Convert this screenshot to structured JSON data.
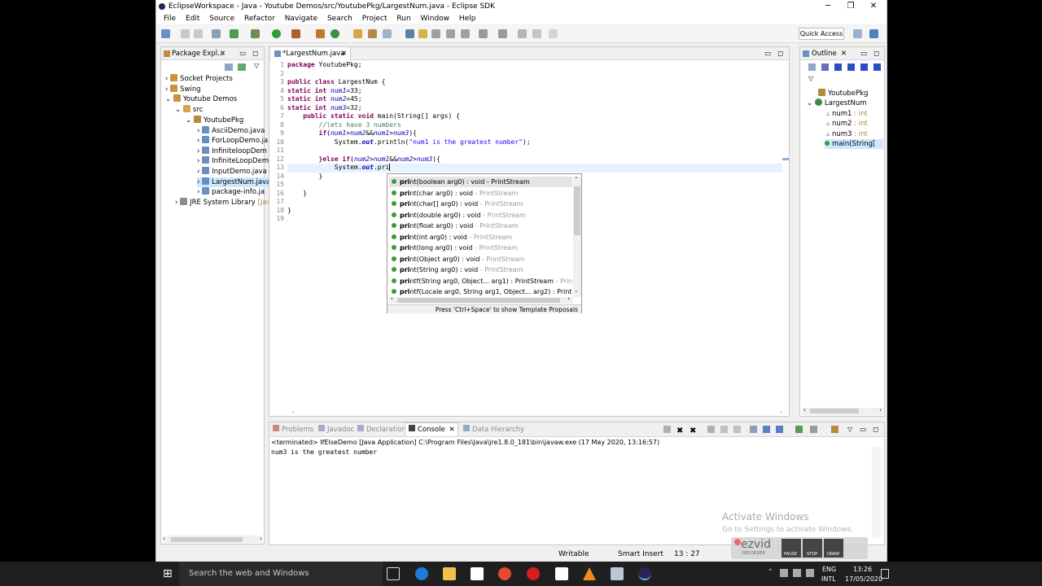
{
  "window": {
    "title": "EclipseWorkspace - Java - Youtube Demos/src/YoutubePkg/LargestNum.java - Eclipse SDK"
  },
  "menu": [
    "File",
    "Edit",
    "Source",
    "Refactor",
    "Navigate",
    "Search",
    "Project",
    "Run",
    "Window",
    "Help"
  ],
  "quick_access": "Quick Access",
  "package_explorer": {
    "tab": "Package Expl...",
    "items": [
      {
        "label": "Socket Projects"
      },
      {
        "label": "Swing"
      },
      {
        "label": "Youtube Demos"
      },
      {
        "label": "src"
      },
      {
        "label": "YoutubePkg"
      },
      {
        "label": "AsciiDemo.java"
      },
      {
        "label": "ForLoopDemo.ja"
      },
      {
        "label": "InfiniteloopDem"
      },
      {
        "label": "InfiniteLoopDem"
      },
      {
        "label": "InputDemo.java"
      },
      {
        "label": "LargestNum.java"
      },
      {
        "label": "package-info.ja"
      },
      {
        "label": "JRE System Library"
      },
      {
        "label": "[Java"
      }
    ]
  },
  "editor": {
    "tab": "*LargestNum.java",
    "lines": [
      "1",
      "2",
      "3",
      "4",
      "5",
      "6",
      "7",
      "8",
      "9",
      "10",
      "11",
      "12",
      "13",
      "14",
      "15",
      "16",
      "17",
      "18",
      "19"
    ],
    "code": {
      "l1a": "package",
      "l1b": " YoutubePkg;",
      "l3a": "public class",
      "l3b": " LargestNum {",
      "static": "static int",
      "num1": "num1",
      "num2": "num2",
      "num3": "num3",
      "v33": "=33;",
      "v45": "=45;",
      "v32": "=32;",
      "l7a": "    public static void",
      "l7b": " main(String[] args) {",
      "l8": "        //lets have 3 numbers",
      "if1a": "        if(",
      "if1b": ">",
      "if1c": "&&",
      "if1d": ">",
      "if1e": "){",
      "l10a": "            System.",
      "out": "out",
      "l10b": ".println(",
      "l10c": "\"num1 is the greatest number\"",
      "l10d": ");",
      "l12a": "        }else if(",
      "l12b": "){",
      "l13": "            System.",
      "l13b": ".pri",
      "l14": "        }",
      "l16": "    }",
      "l18": "}"
    }
  },
  "autocomplete": {
    "items": [
      {
        "bold": "pri",
        "rest": "nt(boolean arg0) : void - PrintStream",
        "type": ""
      },
      {
        "bold": "pri",
        "rest": "nt(char arg0) : void",
        "type": " - PrintStream"
      },
      {
        "bold": "pri",
        "rest": "nt(char[] arg0) : void",
        "type": " - PrintStream"
      },
      {
        "bold": "pri",
        "rest": "nt(double arg0) : void",
        "type": " - PrintStream"
      },
      {
        "bold": "pri",
        "rest": "nt(float arg0) : void",
        "type": " - PrintStream"
      },
      {
        "bold": "pri",
        "rest": "nt(int arg0) : void",
        "type": " - PrintStream"
      },
      {
        "bold": "pri",
        "rest": "nt(long arg0) : void",
        "type": " - PrintStream"
      },
      {
        "bold": "pri",
        "rest": "nt(Object arg0) : void",
        "type": " - PrintStream"
      },
      {
        "bold": "pri",
        "rest": "nt(String arg0) : void",
        "type": " - PrintStream"
      },
      {
        "bold": "pri",
        "rest": "ntf(String arg0, Object... arg1) : PrintStream",
        "type": " - PrintStrea"
      },
      {
        "bold": "pri",
        "rest": "ntf(Locale arg0, String arg1, Object... arg2) : PrintStrean",
        "type": ""
      }
    ],
    "hint": "Press 'Ctrl+Space' to show Template Proposals"
  },
  "outline": {
    "tab": "Outline",
    "items": [
      {
        "label": "YoutubePkg",
        "type": ""
      },
      {
        "label": "LargestNum",
        "type": ""
      },
      {
        "label": "num1",
        "type": " : int"
      },
      {
        "label": "num2",
        "type": " : int"
      },
      {
        "label": "num3",
        "type": " : int"
      },
      {
        "label": "main(String[",
        "type": ""
      }
    ]
  },
  "bottom_tabs": [
    "Problems",
    "Javadoc",
    "Declaration",
    "Console",
    "Data Hierarchy"
  ],
  "console": {
    "header": "<terminated> IfElseDemo [Java Application] C:\\Program Files\\Java\\jre1.8.0_181\\bin\\javaw.exe (17 May 2020, 13:16:57)",
    "output": "num3 is the greatest number"
  },
  "statusbar": {
    "writable": "Writable",
    "insert": "Smart Insert",
    "position": "13 : 27"
  },
  "watermark": {
    "activate": "Activate Windows",
    "goto": "Go to Settings to activate Windows."
  },
  "recorder": {
    "brand": "ezvid",
    "sub": "RECORDER",
    "pause": "PAUSE",
    "stop": "STOP",
    "draw": "DRAW"
  },
  "taskbar": {
    "search": "Search the web and Windows",
    "lang1": "ENG",
    "lang2": "INTL",
    "time": "13:26",
    "date": "17/05/2020"
  },
  "colors": {
    "accent": "#0078d7",
    "selection": "#cde8ff",
    "taskbar": "#1f1f1f"
  }
}
